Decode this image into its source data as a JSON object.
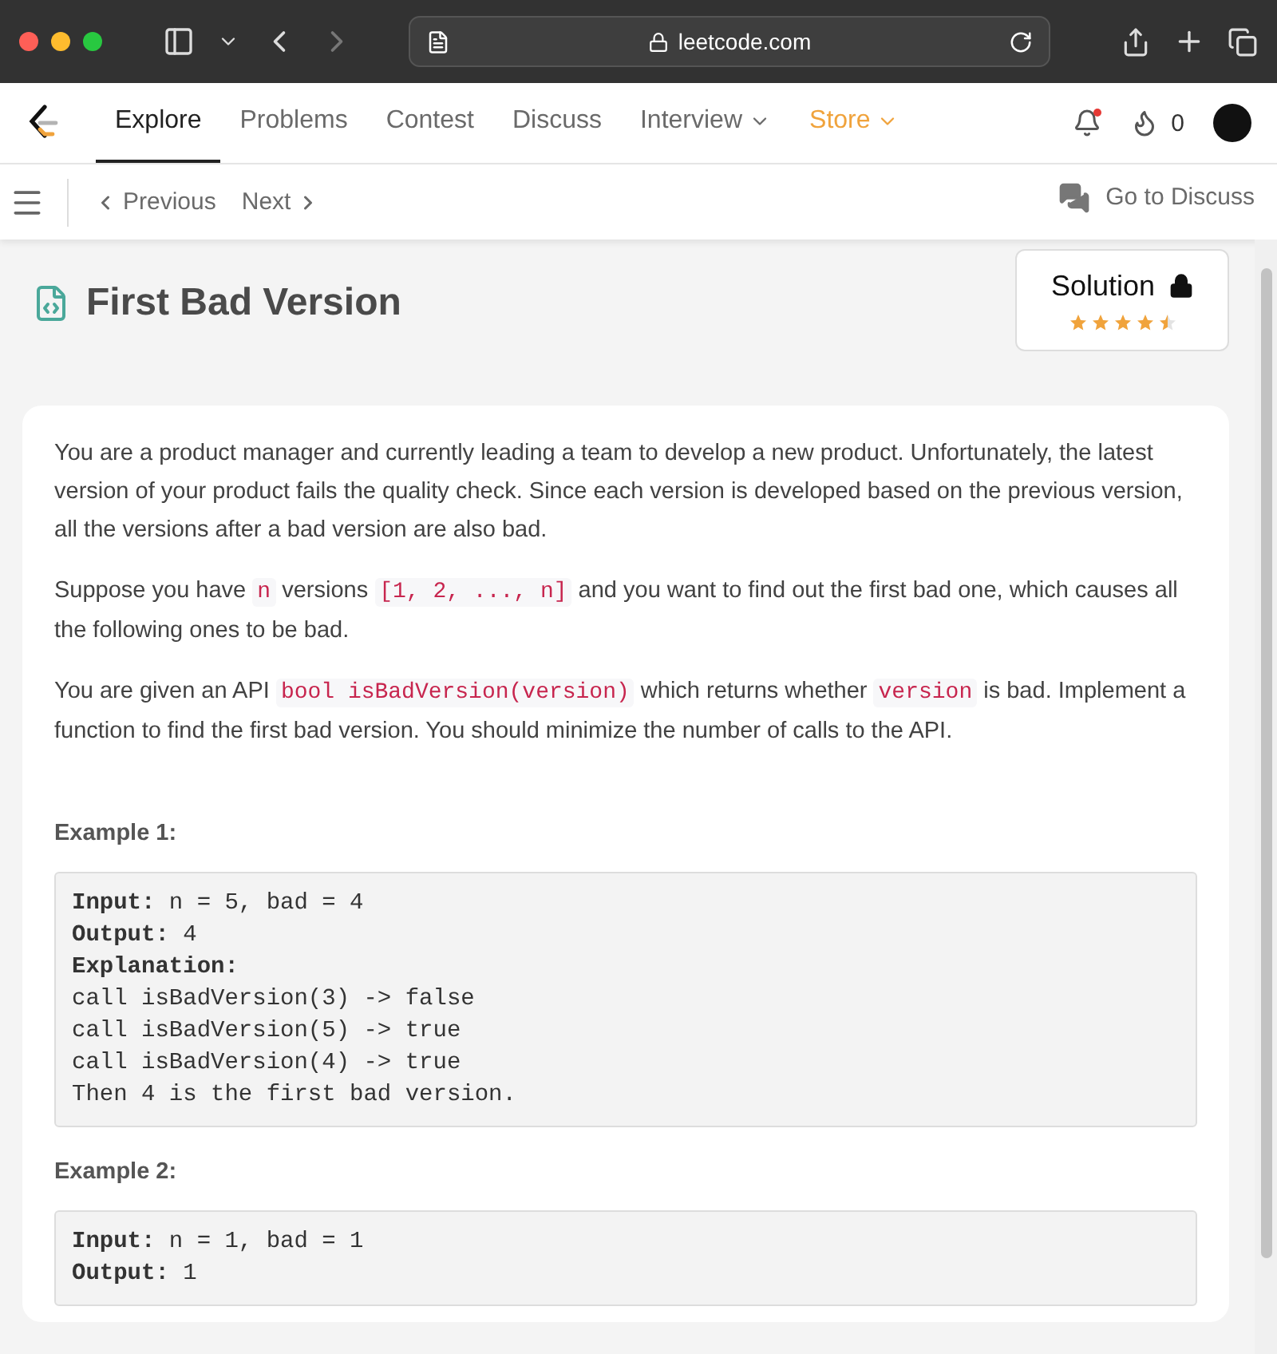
{
  "browser": {
    "address": "leetcode.com"
  },
  "nav": {
    "items": [
      {
        "label": "Explore",
        "selected": true,
        "kind": "plain"
      },
      {
        "label": "Problems",
        "selected": false,
        "kind": "plain"
      },
      {
        "label": "Contest",
        "selected": false,
        "kind": "plain"
      },
      {
        "label": "Discuss",
        "selected": false,
        "kind": "plain"
      },
      {
        "label": "Interview",
        "selected": false,
        "kind": "menu"
      },
      {
        "label": "Store",
        "selected": false,
        "kind": "store"
      }
    ],
    "notification": true,
    "streak": "0"
  },
  "subbar": {
    "previous": "Previous",
    "next": "Next",
    "discuss": "Go to Discuss"
  },
  "problem": {
    "title": "First Bad Version",
    "solution": {
      "label": "Solution",
      "locked": true,
      "stars": 4.5
    },
    "paragraphs": [
      [
        {
          "text": "You are a product manager and currently leading a team to develop a new product. Unfortunately, the latest version of your product fails the quality check. Since each version is developed based on the previous version, all the versions after a bad version are also bad.",
          "code": false
        }
      ],
      [
        {
          "text": "Suppose you have ",
          "code": false
        },
        {
          "text": "n",
          "code": true
        },
        {
          "text": " versions ",
          "code": false
        },
        {
          "text": "[1, 2, ..., n]",
          "code": true
        },
        {
          "text": " and you want to find out the first bad one, which causes all the following ones to be bad.",
          "code": false
        }
      ],
      [
        {
          "text": "You are given an API ",
          "code": false
        },
        {
          "text": "bool isBadVersion(version)",
          "code": true
        },
        {
          "text": " which returns whether ",
          "code": false
        },
        {
          "text": "version",
          "code": true
        },
        {
          "text": " is bad. Implement a function to find the first bad version. You should minimize the number of calls to the API.",
          "code": false
        }
      ]
    ],
    "examples": [
      {
        "title": "Example 1:",
        "lines": [
          "**Input:** n = 5, bad = 4",
          "**Output:** 4",
          "**Explanation:**",
          "call isBadVersion(3) -> false",
          "call isBadVersion(5) -> true",
          "call isBadVersion(4) -> true",
          "Then 4 is the first bad version."
        ]
      },
      {
        "title": "Example 2:",
        "lines": [
          "**Input:** n = 1, bad = 1",
          "**Output:** 1"
        ]
      }
    ]
  }
}
